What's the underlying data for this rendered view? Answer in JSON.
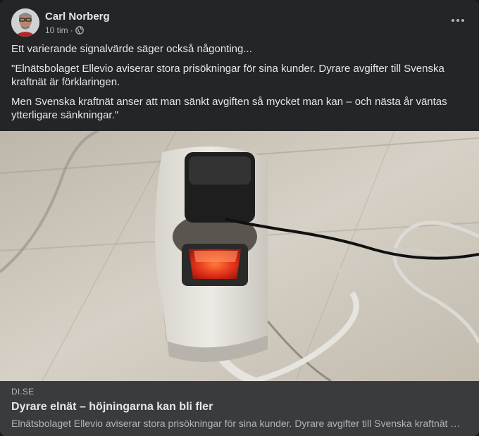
{
  "post": {
    "author": "Carl Norberg",
    "time": "10 tim",
    "separator": "·",
    "privacy_icon": "globe-icon",
    "more_icon": "more-options-icon",
    "paragraphs": [
      "Ett varierande signalvärde säger också någonting...",
      "\"Elnätsbolaget Ellevio aviserar stora prisökningar för sina kunder. Dyrare avgifter till Svenska kraftnät är förklaringen.",
      "Men Svenska kraftnät anser att man sänkt avgiften så mycket man kan – och nästa år väntas ytterligare sänkningar.\""
    ]
  },
  "link": {
    "domain": "DI.SE",
    "title": "Dyrare elnät – höjningarna kan bli fler",
    "description": "Elnätsbolaget Ellevio aviserar stora prisökningar för sina kunder. Dyrare avgifter till Svenska kraftnät är förklaringen."
  },
  "colors": {
    "card_background": "#242526",
    "link_background": "#3a3b3c",
    "primary_text": "#e4e6eb",
    "secondary_text": "#b0b3b8",
    "switch_red": "#e3321b"
  }
}
